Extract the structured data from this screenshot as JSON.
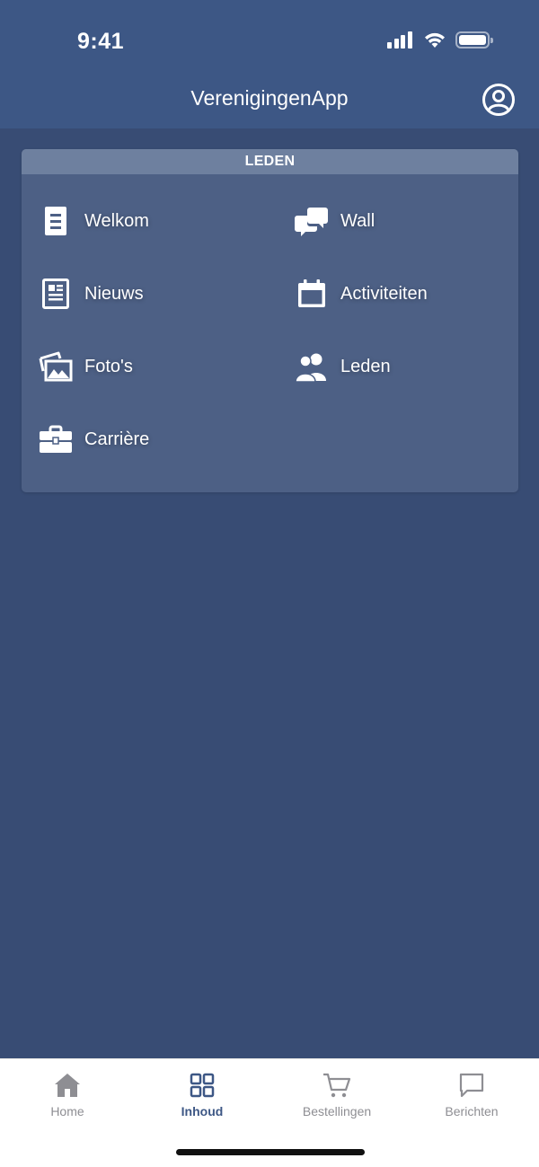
{
  "status_bar": {
    "time": "9:41"
  },
  "header": {
    "title": "VerenigingenApp"
  },
  "section": {
    "title": "LEDEN",
    "items": [
      {
        "label": "Welkom",
        "icon": "document-icon"
      },
      {
        "label": "Wall",
        "icon": "chat-bubbles-icon"
      },
      {
        "label": "Nieuws",
        "icon": "newspaper-icon"
      },
      {
        "label": "Activiteiten",
        "icon": "calendar-icon"
      },
      {
        "label": "Foto's",
        "icon": "photos-icon"
      },
      {
        "label": "Leden",
        "icon": "members-icon"
      },
      {
        "label": "Carrière",
        "icon": "briefcase-icon"
      }
    ]
  },
  "tabbar": {
    "tabs": [
      {
        "label": "Home",
        "icon": "home-icon",
        "active": false
      },
      {
        "label": "Inhoud",
        "icon": "grid-icon",
        "active": true
      },
      {
        "label": "Bestellingen",
        "icon": "cart-icon",
        "active": false
      },
      {
        "label": "Berichten",
        "icon": "message-icon",
        "active": false
      }
    ]
  },
  "colors": {
    "header_bg": "#3d5785",
    "page_bg": "#384c74",
    "card_bg": "#4d6085",
    "card_header_bg": "#6e809f",
    "tab_active": "#3d5785",
    "tab_inactive": "#8e8e93"
  }
}
